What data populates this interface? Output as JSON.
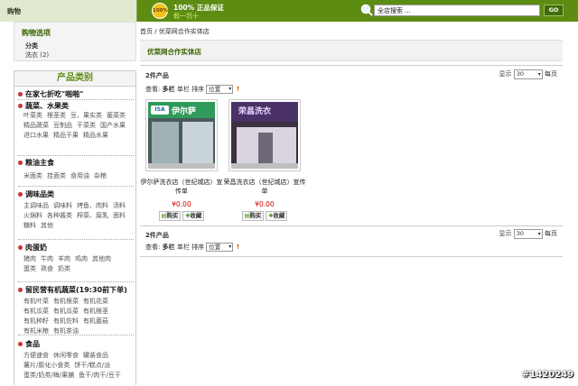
{
  "topbar": {
    "cart_label": "购物",
    "badge": "100%",
    "guarantee_line1": "100% 正品保证",
    "guarantee_line2": "假一罚十",
    "search_value": "全店搜索 ...",
    "search_button": "GO",
    "accent": "#5d8c13"
  },
  "sidebar": {
    "options_title": "购物选项",
    "options_sub": "分类",
    "options_item": "洗衣 (2)",
    "categories_title": "产品类别",
    "categories": [
      {
        "title": "在家七折吃\"啪啪\"",
        "links": []
      },
      {
        "title": "蔬菜、水果类",
        "links": [
          "叶菜类",
          "根茎类",
          "豆、果实类",
          "菌菜类",
          "精品蔬菜",
          "豆制品",
          "干菜类",
          "国产水果",
          "进口水果",
          "精品干果",
          "精品水果"
        ]
      },
      {
        "title": "粮油主食",
        "links": [
          "米面类",
          "挂面类",
          "食用油",
          "杂粮"
        ]
      },
      {
        "title": "调味品类",
        "links": [
          "主调味品",
          "调味料",
          "烤鱼、肉料",
          "汤料",
          "火锅料",
          "各种酱类",
          "榨菜、腐乳",
          "面料",
          "糖料",
          "其他"
        ]
      },
      {
        "title": "肉蛋奶",
        "links": [
          "猪肉",
          "牛肉",
          "羊肉",
          "鸡肉",
          "其他肉",
          "蛋类",
          "熟食",
          "奶类"
        ]
      },
      {
        "title": "留民营有机蔬菜(19:30前下单)",
        "links": [
          "有机叶菜",
          "有机根菜",
          "有机花菜",
          "有机瓜菜",
          "有机瓜菜",
          "有机根茎",
          "有机种籽",
          "有机佐料",
          "有机菌菇",
          "有机米粮",
          "有机茶油"
        ]
      },
      {
        "title": "食品",
        "links": [
          "方便速食",
          "休闲零食",
          "罐装食品",
          "薯片/膨化小食类",
          "饼干/糕点/派",
          "蛋类/奶类/梅/果脯",
          "鱼干/肉干/豆干"
        ]
      }
    ]
  },
  "main": {
    "breadcrumb": "首页 / 优菜网合作实体店",
    "store_title": "优菜网合作实体店",
    "count_label": "2件产品",
    "per_page_prefix": "显示",
    "per_page_value": "30",
    "per_page_suffix": "每页",
    "view_prefix": "查看:",
    "view_multi": "多栏",
    "view_single": "单栏",
    "sort_label": "排序",
    "sort_value": "位置",
    "products": [
      {
        "name": "伊尔萨洗衣店（世纪城店）宣传单",
        "price": "¥0.00",
        "buy": "购买",
        "fav": "收藏",
        "sign": "伊尔萨"
      },
      {
        "name": "荣昌洗衣店（世纪城店）宣传单",
        "price": "¥0.00",
        "buy": "购买",
        "fav": "收藏",
        "sign": "荣昌洗衣"
      }
    ]
  },
  "watermark": "#1420249"
}
